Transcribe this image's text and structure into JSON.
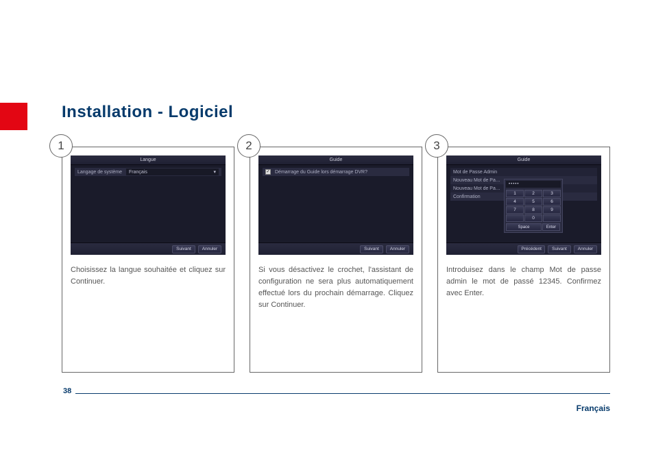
{
  "page": {
    "title": "Installation - Logiciel",
    "number": "38",
    "language": "Français"
  },
  "steps": [
    {
      "num": "1",
      "caption": "Choisissez la langue souhaitée et cliquez sur Continuer.",
      "dvr": {
        "title": "Langue",
        "row_label": "Langage de système",
        "row_value": "Français",
        "buttons": {
          "next": "Suivant",
          "cancel": "Annuler"
        }
      }
    },
    {
      "num": "2",
      "caption": "Si vous désactivez le crochet, l'assistant de configuration ne sera plus automatiquement effectué lors du prochain démarrage. Cliquez sur Continuer.",
      "dvr": {
        "title": "Guide",
        "check_label": "Démarrage du Guide lors démarrage DVR?",
        "checked": "✓",
        "buttons": {
          "next": "Suivant",
          "cancel": "Annuler"
        }
      }
    },
    {
      "num": "3",
      "caption": "Introduisez dans le champ Mot de passe admin le mot de passé 12345. Confirmez avec Enter.",
      "dvr": {
        "title": "Guide",
        "rows": [
          "Mot de Passe Admin",
          "Nouveau Mot de Pa…",
          "Nouveau Mot de Pa…",
          "Confirmation"
        ],
        "field_mask": "•••••",
        "keypad": [
          "1",
          "2",
          "3",
          "4",
          "5",
          "6",
          "7",
          "8",
          "9",
          "",
          "0",
          ""
        ],
        "keypad_bottom": {
          "space": "Space",
          "enter": "Enter"
        },
        "buttons": {
          "prev": "Précédent",
          "next": "Suivant",
          "cancel": "Annuler"
        }
      }
    }
  ]
}
